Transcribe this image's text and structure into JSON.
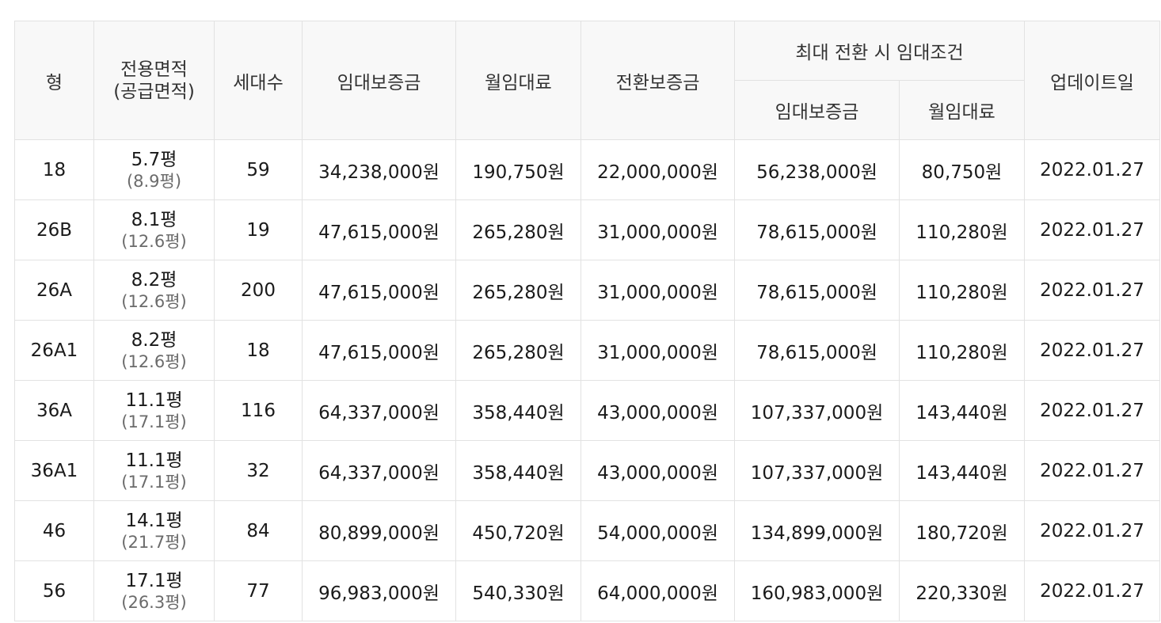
{
  "table": {
    "headers": {
      "type": "형",
      "area_line1": "전용면적",
      "area_line2": "(공급면적)",
      "households": "세대수",
      "deposit": "임대보증금",
      "monthly_rent": "월임대료",
      "conversion_deposit": "전환보증금",
      "max_conversion_group": "최대 전환 시 임대조건",
      "max_deposit": "임대보증금",
      "max_monthly_rent": "월임대료",
      "updated": "업데이트일"
    },
    "rows": [
      {
        "type": "18",
        "area": "5.7평",
        "supply": "(8.9평)",
        "households": "59",
        "deposit": "34,238,000원",
        "rent": "190,750원",
        "conversion": "22,000,000원",
        "max_deposit": "56,238,000원",
        "max_rent": "80,750원",
        "updated": "2022.01.27"
      },
      {
        "type": "26B",
        "area": "8.1평",
        "supply": "(12.6평)",
        "households": "19",
        "deposit": "47,615,000원",
        "rent": "265,280원",
        "conversion": "31,000,000원",
        "max_deposit": "78,615,000원",
        "max_rent": "110,280원",
        "updated": "2022.01.27"
      },
      {
        "type": "26A",
        "area": "8.2평",
        "supply": "(12.6평)",
        "households": "200",
        "deposit": "47,615,000원",
        "rent": "265,280원",
        "conversion": "31,000,000원",
        "max_deposit": "78,615,000원",
        "max_rent": "110,280원",
        "updated": "2022.01.27"
      },
      {
        "type": "26A1",
        "area": "8.2평",
        "supply": "(12.6평)",
        "households": "18",
        "deposit": "47,615,000원",
        "rent": "265,280원",
        "conversion": "31,000,000원",
        "max_deposit": "78,615,000원",
        "max_rent": "110,280원",
        "updated": "2022.01.27"
      },
      {
        "type": "36A",
        "area": "11.1평",
        "supply": "(17.1평)",
        "households": "116",
        "deposit": "64,337,000원",
        "rent": "358,440원",
        "conversion": "43,000,000원",
        "max_deposit": "107,337,000원",
        "max_rent": "143,440원",
        "updated": "2022.01.27"
      },
      {
        "type": "36A1",
        "area": "11.1평",
        "supply": "(17.1평)",
        "households": "32",
        "deposit": "64,337,000원",
        "rent": "358,440원",
        "conversion": "43,000,000원",
        "max_deposit": "107,337,000원",
        "max_rent": "143,440원",
        "updated": "2022.01.27"
      },
      {
        "type": "46",
        "area": "14.1평",
        "supply": "(21.7평)",
        "households": "84",
        "deposit": "80,899,000원",
        "rent": "450,720원",
        "conversion": "54,000,000원",
        "max_deposit": "134,899,000원",
        "max_rent": "180,720원",
        "updated": "2022.01.27"
      },
      {
        "type": "56",
        "area": "17.1평",
        "supply": "(26.3평)",
        "households": "77",
        "deposit": "96,983,000원",
        "rent": "540,330원",
        "conversion": "64,000,000원",
        "max_deposit": "160,983,000원",
        "max_rent": "220,330원",
        "updated": "2022.01.27"
      }
    ]
  }
}
